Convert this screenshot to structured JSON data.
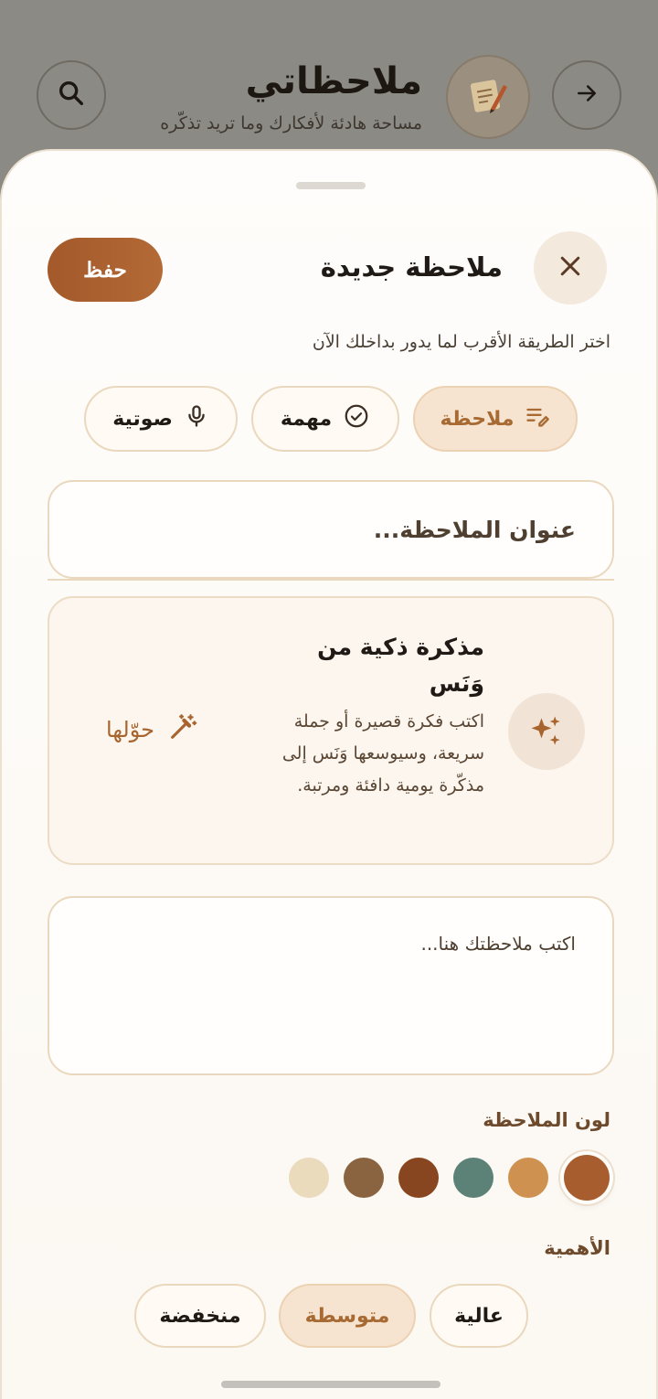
{
  "header": {
    "title": "ملاحظاتي",
    "subtitle": "مساحة هادئة لأفكارك وما تريد تذكّره"
  },
  "sheet": {
    "title": "ملاحظة جديدة",
    "save_label": "حفظ",
    "hint": "اختر الطريقة الأقرب لما يدور بداخلك الآن"
  },
  "types": [
    {
      "label": "ملاحظة",
      "icon": "note-edit-icon",
      "active": true
    },
    {
      "label": "مهمة",
      "icon": "check-circle-icon",
      "active": false
    },
    {
      "label": "صوتية",
      "icon": "microphone-icon",
      "active": false
    }
  ],
  "title_field": {
    "placeholder": "عنوان الملاحظة...",
    "value": ""
  },
  "ai_card": {
    "title": "مذكرة ذكية من وَنَس",
    "description": "اكتب فكرة قصيرة أو جملة سريعة، وسيوسعها وَنَس إلى مذكّرة يومية دافئة ومرتبة.",
    "action_label": "حوّلها"
  },
  "body_field": {
    "placeholder": "اكتب ملاحظتك هنا...",
    "value": ""
  },
  "color_section": {
    "label": "لون الملاحظة",
    "colors": [
      "#a85d2e",
      "#cf914f",
      "#5c8278",
      "#87461f",
      "#8a6441",
      "#eadbbd"
    ],
    "selected": "#a85d2e"
  },
  "priority_section": {
    "label": "الأهمية",
    "options": [
      {
        "label": "عالية",
        "active": false
      },
      {
        "label": "متوسطة",
        "active": true
      },
      {
        "label": "منخفضة",
        "active": false
      }
    ]
  },
  "colors": {
    "accent": "#a85d2e",
    "accent_soft": "#f6e4d0",
    "border": "#ead8be"
  }
}
